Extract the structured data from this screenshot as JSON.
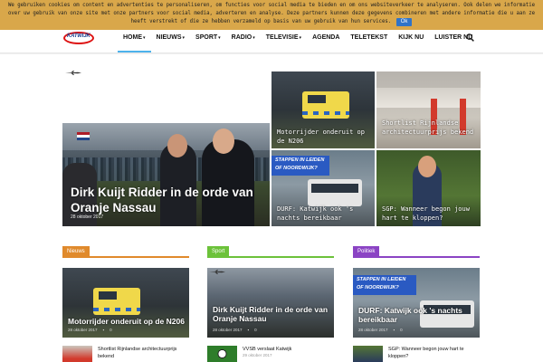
{
  "cookie": {
    "text": "We gebruiken cookies om content en advertenties te personaliseren, om functies voor social media te bieden en om ons websiteverkeer te analyseren. Ook delen we informatie over uw gebruik van onze site met onze partners voor social media, adverteren en analyse. Deze partners kunnen deze gegevens combineren met andere informatie die u aan ze heeft verstrekt of die ze hebben verzameld op basis van uw gebruik van hun services.",
    "ok_label": "Ok"
  },
  "logo_text": "KATWIJK",
  "nav": [
    {
      "label": "HOME",
      "caret": "▾"
    },
    {
      "label": "NIEUWS",
      "caret": "▾"
    },
    {
      "label": "SPORT",
      "caret": "▾"
    },
    {
      "label": "RADIO",
      "caret": "▾"
    },
    {
      "label": "TELEVISIE",
      "caret": "▾"
    },
    {
      "label": "AGENDA",
      "caret": ""
    },
    {
      "label": "TELETEKST",
      "caret": ""
    },
    {
      "label": "KIJK NU",
      "caret": ""
    },
    {
      "label": "LUISTER NU",
      "caret": ""
    }
  ],
  "featured": {
    "main": {
      "title": "Dirk Kuijt Ridder in de orde van Oranje Nassau",
      "date": "28 oktober 2017"
    },
    "tiles": [
      {
        "title": "Motorrijder onderuit op de N206"
      },
      {
        "title": "Shortlist Rijnlandse architectuurprijs bekend"
      },
      {
        "title": "DURF: Katwijk ook 's nachts bereikbaar",
        "banner": "Stappen in Leiden of Noordwijk?"
      },
      {
        "title": "SGP: Wanneer begon jouw hart te kloppen?"
      }
    ]
  },
  "columns": [
    {
      "label": "Nieuws",
      "color": "#e08a2c",
      "tile": {
        "title": "Motorrijder onderuit op de N206",
        "date": "28 oktober 2017",
        "comments": "0"
      },
      "small": {
        "title": "Shortlist Rijnlandse architectuurprijs bekend",
        "date": ""
      }
    },
    {
      "label": "Sport",
      "color": "#6cc23a",
      "tile": {
        "title": "Dirk Kuijt Ridder in de orde van Oranje Nassau",
        "date": "28 oktober 2017",
        "comments": "0"
      },
      "small": {
        "title": "VVSB verslaat Katwijk",
        "date": "29 oktober 2017"
      }
    },
    {
      "label": "Politiek",
      "color": "#8b44c4",
      "tile": {
        "title": "DURF: Katwijk ook 's nachts bereikbaar",
        "date": "28 oktober 2017",
        "comments": "0",
        "banner": "Stappen in Leiden of Noordwijk?"
      },
      "small": {
        "title": "SGP: Wanneer begon jouw hart te kloppen?",
        "date": ""
      }
    }
  ]
}
